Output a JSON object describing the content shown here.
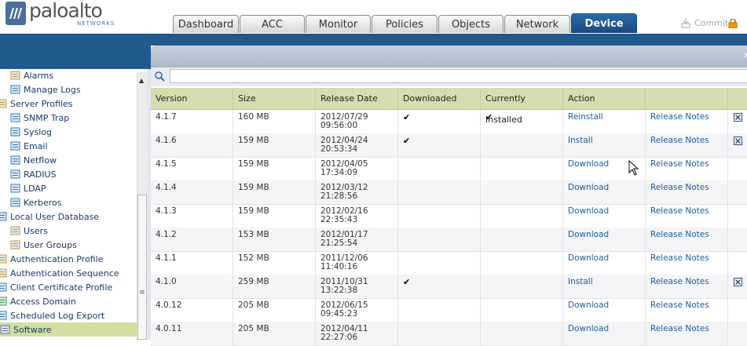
{
  "logo": {
    "name": "paloalto",
    "sub": "NETWORKS"
  },
  "tabs": [
    {
      "label": "Dashboard",
      "active": false
    },
    {
      "label": "ACC",
      "active": false
    },
    {
      "label": "Monitor",
      "active": false
    },
    {
      "label": "Policies",
      "active": false
    },
    {
      "label": "Objects",
      "active": false
    },
    {
      "label": "Network",
      "active": false
    },
    {
      "label": "Device",
      "active": true
    }
  ],
  "header": {
    "commit_label": "Commit"
  },
  "sidebar": {
    "items": [
      {
        "label": "Alarms",
        "icon": "alarm-icon"
      },
      {
        "label": "Manage Logs",
        "icon": "logs-icon"
      },
      {
        "label": "Server Profiles",
        "icon": "server-profiles-icon"
      },
      {
        "label": "SNMP Trap",
        "icon": "snmp-icon"
      },
      {
        "label": "Syslog",
        "icon": "syslog-icon"
      },
      {
        "label": "Email",
        "icon": "email-icon"
      },
      {
        "label": "Netflow",
        "icon": "netflow-icon"
      },
      {
        "label": "RADIUS",
        "icon": "radius-icon"
      },
      {
        "label": "LDAP",
        "icon": "ldap-icon"
      },
      {
        "label": "Kerberos",
        "icon": "kerberos-icon"
      },
      {
        "label": "Local User Database",
        "icon": "database-icon"
      },
      {
        "label": "Users",
        "icon": "user-icon"
      },
      {
        "label": "User Groups",
        "icon": "user-groups-icon"
      },
      {
        "label": "Authentication Profile",
        "icon": "auth-profile-icon"
      },
      {
        "label": "Authentication Sequence",
        "icon": "auth-sequence-icon"
      },
      {
        "label": "Client Certificate Profile",
        "icon": "certificate-icon"
      },
      {
        "label": "Access Domain",
        "icon": "access-domain-icon"
      },
      {
        "label": "Scheduled Log Export",
        "icon": "log-export-icon"
      },
      {
        "label": "Software",
        "icon": "software-icon",
        "selected": true
      }
    ]
  },
  "search": {
    "placeholder": ""
  },
  "table": {
    "columns": [
      "Version",
      "Size",
      "Release Date",
      "Downloaded",
      "Currently Installed",
      "Action",
      ""
    ],
    "rows": [
      {
        "version": "4.1.7",
        "size": "160 MB",
        "date": "2012/07/29",
        "time": "09:56:00",
        "downloaded": "✔",
        "installed": "✔",
        "action": "Reinstall",
        "notes": "Release Notes",
        "delete": true
      },
      {
        "version": "4.1.6",
        "size": "159 MB",
        "date": "2012/04/24",
        "time": "20:53:34",
        "downloaded": "✔",
        "installed": "",
        "action": "Install",
        "notes": "Release Notes",
        "delete": true
      },
      {
        "version": "4.1.5",
        "size": "159 MB",
        "date": "2012/04/05",
        "time": "17:34:09",
        "downloaded": "",
        "installed": "",
        "action": "Download",
        "notes": "Release Notes",
        "delete": false
      },
      {
        "version": "4.1.4",
        "size": "159 MB",
        "date": "2012/03/12",
        "time": "21:28:56",
        "downloaded": "",
        "installed": "",
        "action": "Download",
        "notes": "Release Notes",
        "delete": false
      },
      {
        "version": "4.1.3",
        "size": "159 MB",
        "date": "2012/02/16",
        "time": "22:35:43",
        "downloaded": "",
        "installed": "",
        "action": "Download",
        "notes": "Release Notes",
        "delete": false
      },
      {
        "version": "4.1.2",
        "size": "153 MB",
        "date": "2012/01/17",
        "time": "21:25:54",
        "downloaded": "",
        "installed": "",
        "action": "Download",
        "notes": "Release Notes",
        "delete": false
      },
      {
        "version": "4.1.1",
        "size": "152 MB",
        "date": "2011/12/06",
        "time": "11:40:16",
        "downloaded": "",
        "installed": "",
        "action": "Download",
        "notes": "Release Notes",
        "delete": false
      },
      {
        "version": "4.1.0",
        "size": "259 MB",
        "date": "2011/10/31",
        "time": "13:22:38",
        "downloaded": "✔",
        "installed": "",
        "action": "Install",
        "notes": "Release Notes",
        "delete": true
      },
      {
        "version": "4.0.12",
        "size": "205 MB",
        "date": "2012/06/15",
        "time": "09:45:23",
        "downloaded": "",
        "installed": "",
        "action": "Download",
        "notes": "Release Notes",
        "delete": false
      },
      {
        "version": "4.0.11",
        "size": "205 MB",
        "date": "2012/04/11",
        "time": "22:27:06",
        "downloaded": "",
        "installed": "",
        "action": "Download",
        "notes": "Release Notes",
        "delete": false
      }
    ]
  },
  "colors": {
    "brand_blue": "#235a8c",
    "tab_active": "#1f5a96",
    "header_row": "#d4dfb1",
    "link": "#1f5c99",
    "selected": "#cfe0a2"
  }
}
